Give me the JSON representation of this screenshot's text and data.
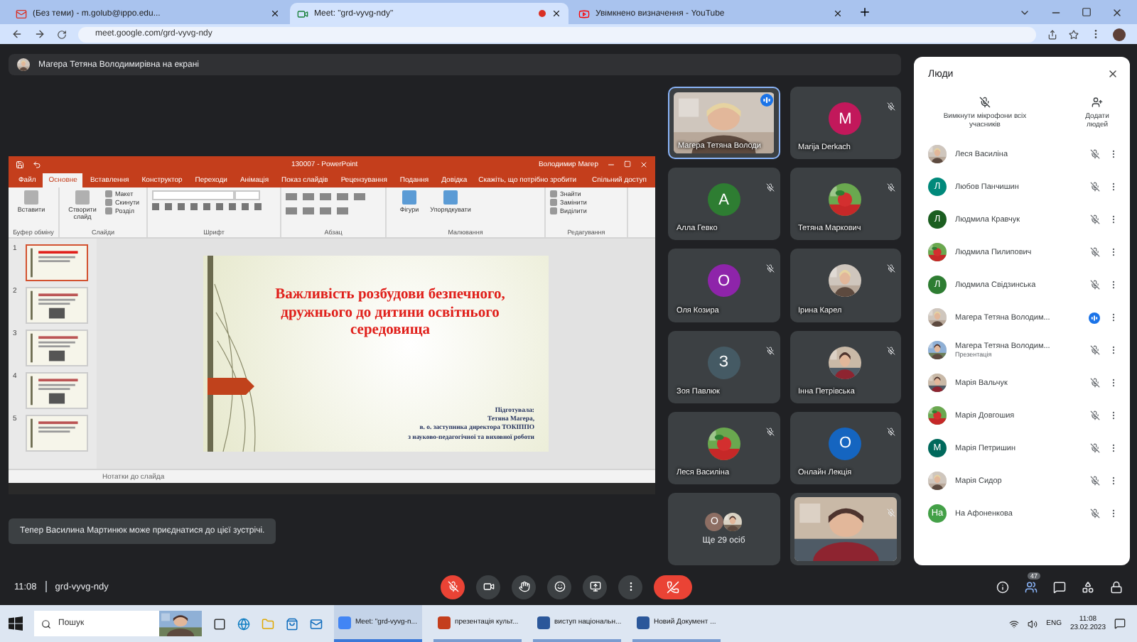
{
  "browser": {
    "tabs": [
      {
        "title": "(Без теми) - m.golub@ippo.edu...",
        "kind": "mail",
        "selected": false,
        "recording": false
      },
      {
        "title": "Meet: \"grd-vyvg-ndy\"",
        "kind": "meet",
        "selected": true,
        "recording": true
      },
      {
        "title": "Увімкнено визначення - YouTube",
        "kind": "video",
        "selected": false,
        "recording": false
      }
    ],
    "url": "meet.google.com/grd-vyvg-ndy"
  },
  "banner": "Магера Тетяна Володимирівна на екрані",
  "presentation": {
    "title": "130007 - PowerPoint",
    "user": "Володимир Магер",
    "ribbon_tabs": [
      {
        "label": "Файл",
        "selected": false
      },
      {
        "label": "Основне",
        "selected": true
      },
      {
        "label": "Вставлення",
        "selected": false
      },
      {
        "label": "Конструктор",
        "selected": false
      },
      {
        "label": "Переходи",
        "selected": false
      },
      {
        "label": "Анімація",
        "selected": false
      },
      {
        "label": "Показ слайдів",
        "selected": false
      },
      {
        "label": "Рецензування",
        "selected": false
      },
      {
        "label": "Подання",
        "selected": false
      },
      {
        "label": "Довідка",
        "selected": false
      }
    ],
    "tell_me": "Скажіть, що потрібно зробити",
    "share": "Спільний доступ",
    "ribbon_groups": [
      {
        "label": "Буфер обміну",
        "kind": "clipboard",
        "buttons": [
          {
            "label": "Вставити",
            "kind": "large"
          }
        ]
      },
      {
        "label": "Слайди",
        "kind": "slides",
        "buttons": [
          {
            "label": "Створити слайд",
            "kind": "large"
          },
          {
            "label": "Макет",
            "kind": "small"
          },
          {
            "label": "Скинути",
            "kind": "small"
          },
          {
            "label": "Розділ",
            "kind": "small"
          }
        ]
      },
      {
        "label": "Шрифт",
        "kind": "font"
      },
      {
        "label": "Абзац",
        "kind": "paragraph"
      },
      {
        "label": "Малювання",
        "kind": "drawing",
        "buttons": [
          {
            "label": "Фігури",
            "kind": "large"
          },
          {
            "label": "Упорядкувати",
            "kind": "large"
          }
        ]
      },
      {
        "label": "Редагування",
        "kind": "editing",
        "buttons": [
          {
            "label": "Знайти",
            "kind": "small"
          },
          {
            "label": "Замінити",
            "kind": "small"
          },
          {
            "label": "Виділити",
            "kind": "small"
          }
        ]
      }
    ],
    "thumbnails": [
      {
        "number": "1",
        "selected": true
      },
      {
        "number": "2",
        "selected": false
      },
      {
        "number": "3",
        "selected": false
      },
      {
        "number": "4",
        "selected": false
      },
      {
        "number": "5",
        "selected": false
      }
    ],
    "slide": {
      "title": "Важливість розбудови безпечного, дружнього до дитини освітнього середовища",
      "author_lines": [
        "Підготувала:",
        "Тетяна Магера,",
        "в. о. заступника директора ТОКІППО",
        "з науково-педагогічної та виховної роботи"
      ]
    },
    "notes": "Нотатки до слайда"
  },
  "toast": "Тепер Василина Мартинюк може приєднатися до цієї зустрічі.",
  "tiles": [
    {
      "name": "Магера Тетяна Володи",
      "kind": "video",
      "speaking": true,
      "muted": false
    },
    {
      "name": "Marija Derkach",
      "kind": "avatar",
      "initial": "M",
      "color": "#c2185b",
      "speaking": false,
      "muted": true
    },
    {
      "name": "Алла Гевко",
      "kind": "avatar",
      "initial": "А",
      "color": "#2e7d32",
      "speaking": false,
      "muted": true
    },
    {
      "name": "Тетяна Маркович",
      "speaking": false,
      "muted": true
    },
    {
      "name": "Оля Козира",
      "kind": "avatar",
      "initial": "О",
      "color": "#8e24aa",
      "speaking": false,
      "muted": true
    },
    {
      "name": "Ірина Карел",
      "speaking": false,
      "muted": true
    },
    {
      "name": "Зоя Павлюк",
      "kind": "avatar",
      "initial": "З",
      "color": "#455a64",
      "speaking": false,
      "muted": true
    },
    {
      "name": "Інна Петрівська",
      "speaking": false,
      "muted": true
    },
    {
      "name": "Леся Василіна",
      "speaking": false,
      "muted": true
    },
    {
      "name": "Онлайн Лекція",
      "kind": "avatar",
      "initial": "О",
      "color": "#1565c0",
      "speaking": false,
      "muted": true
    },
    {
      "name": "Ще 29 осіб",
      "kind": "more",
      "initial": "О",
      "color": "#8d6e63",
      "speaking": false,
      "muted": false
    },
    {
      "kind": "video",
      "speaking": false,
      "muted": true
    }
  ],
  "people": {
    "title": "Люди",
    "actions": [
      {
        "label": "Вимкнути мікрофони всіх учасників",
        "kind": "mute"
      },
      {
        "label": "Додати людей",
        "kind": "add"
      }
    ],
    "items": [
      {
        "name": "Леся Василіна",
        "speaking": false
      },
      {
        "name": "Любов Панчишин",
        "kind": "letter",
        "initial": "Л",
        "color": "#00897b",
        "speaking": false
      },
      {
        "name": "Людмила Кравчук",
        "kind": "letter",
        "initial": "Л",
        "color": "#1b5e20",
        "speaking": false
      },
      {
        "name": "Людмила Пилипович",
        "speaking": false
      },
      {
        "name": "Людмила Свідзинська",
        "kind": "letter",
        "initial": "Л",
        "color": "#2e7d32",
        "speaking": false
      },
      {
        "name": "Магера Тетяна Володим...",
        "speaking": true
      },
      {
        "name": "Магера Тетяна Володим...",
        "subtitle": "Презентація",
        "speaking": false
      },
      {
        "name": "Марія Вальчук",
        "speaking": false
      },
      {
        "name": "Марія Довгошия",
        "speaking": false
      },
      {
        "name": "Марія Петришин",
        "kind": "letter",
        "initial": "М",
        "color": "#00695c",
        "speaking": false
      },
      {
        "name": "Марія Сидор",
        "speaking": false
      },
      {
        "name": "На Афоненкова",
        "kind": "letter",
        "initial": "На",
        "color": "#43a047",
        "speaking": false
      }
    ]
  },
  "footer": {
    "time": "11:08",
    "code": "grd-vyvg-ndy",
    "participants": "47"
  },
  "taskbar": {
    "search": "Пошук",
    "apps": [
      {
        "label": "Meet: \"grd-vyvg-n...",
        "kind": "chrome",
        "selected": true
      },
      {
        "label": "презентація культ...",
        "kind": "powerpoint",
        "selected": false
      },
      {
        "label": "виступ національн...",
        "kind": "word",
        "selected": false
      },
      {
        "label": "Новий Документ ...",
        "kind": "word",
        "selected": false
      }
    ],
    "language": "ENG",
    "time": "11:08",
    "date": "23.02.2023"
  }
}
